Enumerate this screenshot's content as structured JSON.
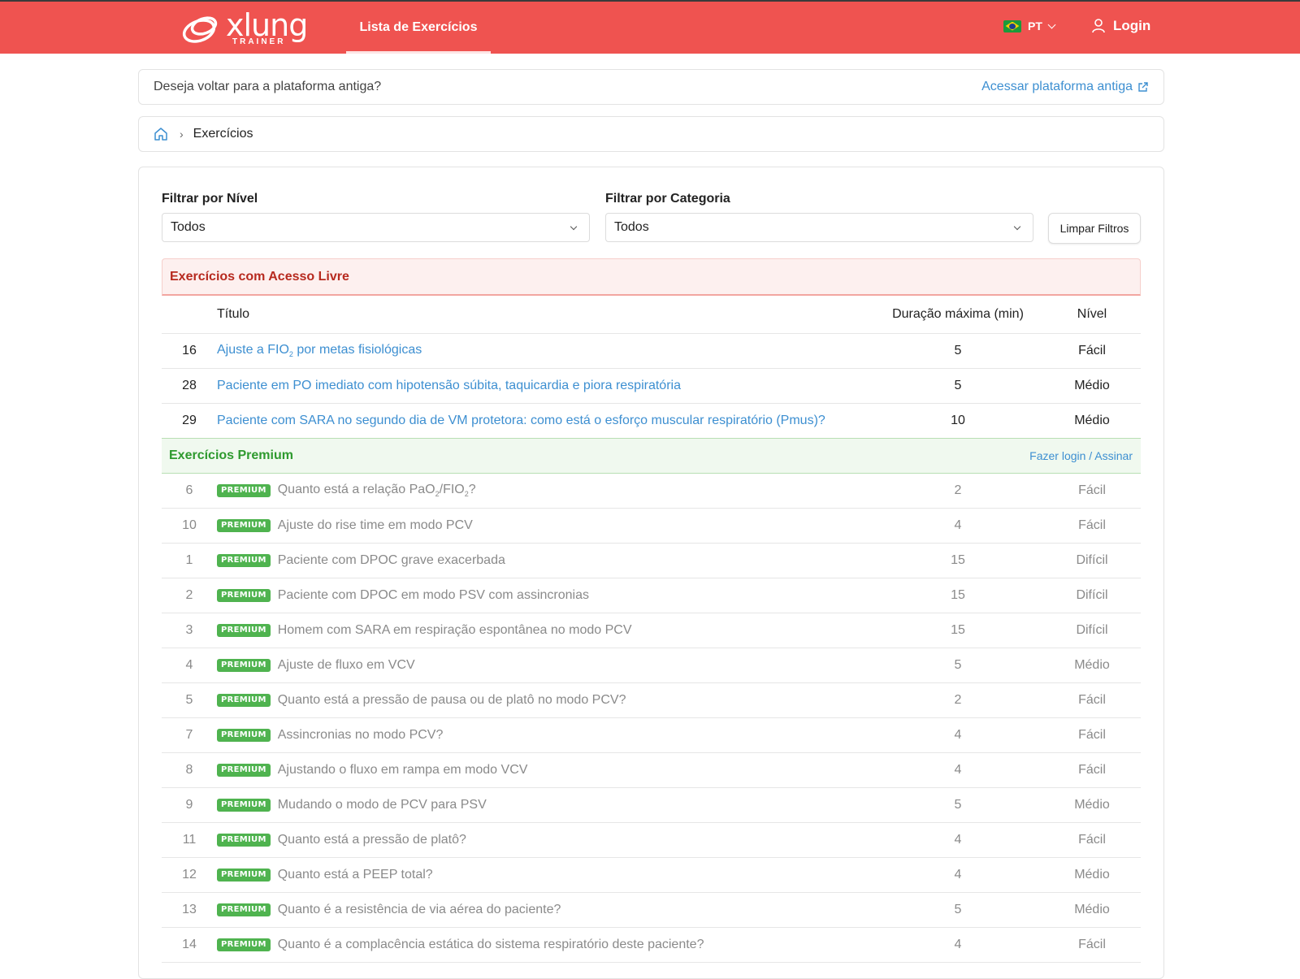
{
  "header": {
    "logo_main": "xlung",
    "logo_sub": "TRAINER",
    "nav_tab": "Lista de Exercícios",
    "lang": "PT",
    "login": "Login"
  },
  "notice": {
    "text": "Deseja voltar para a plataforma antiga?",
    "link": "Acessar plataforma antiga"
  },
  "breadcrumb": {
    "current": "Exercícios"
  },
  "filters": {
    "level_label": "Filtrar por Nível",
    "level_value": "Todos",
    "category_label": "Filtrar por Categoria",
    "category_value": "Todos",
    "clear_button": "Limpar Filtros"
  },
  "free_section": {
    "title": "Exercícios com Acesso Livre",
    "columns": {
      "title": "Título",
      "duration": "Duração máxima (min)",
      "level": "Nível"
    },
    "rows": [
      {
        "id": "16",
        "title_pre": "Ajuste a FIO",
        "title_sub": "2",
        "title_post": " por metas fisiológicas",
        "duration": "5",
        "level": "Fácil"
      },
      {
        "id": "28",
        "title": "Paciente em PO imediato com hipotensão súbita, taquicardia e piora respiratória",
        "duration": "5",
        "level": "Médio"
      },
      {
        "id": "29",
        "title": "Paciente com SARA no segundo dia de VM protetora: como está o esforço muscular respiratório (Pmus)?",
        "duration": "10",
        "level": "Médio"
      }
    ]
  },
  "premium_section": {
    "title": "Exercícios Premium",
    "link": "Fazer login / Assinar",
    "badge": "PREMIUM",
    "rows": [
      {
        "id": "6",
        "title_a": "Quanto está a relação PaO",
        "sub1": "2",
        "title_b": "/FIO",
        "sub2": "2",
        "title_c": "?",
        "duration": "2",
        "level": "Fácil"
      },
      {
        "id": "10",
        "title": "Ajuste do rise time em modo PCV",
        "duration": "4",
        "level": "Fácil"
      },
      {
        "id": "1",
        "title": "Paciente com DPOC grave exacerbada",
        "duration": "15",
        "level": "Difícil"
      },
      {
        "id": "2",
        "title": "Paciente com DPOC em modo PSV com assincronias",
        "duration": "15",
        "level": "Difícil"
      },
      {
        "id": "3",
        "title": "Homem com SARA em respiração espontânea no modo PCV",
        "duration": "15",
        "level": "Difícil"
      },
      {
        "id": "4",
        "title": "Ajuste de fluxo em VCV",
        "duration": "5",
        "level": "Médio"
      },
      {
        "id": "5",
        "title": "Quanto está a pressão de pausa ou de platô no modo PCV?",
        "duration": "2",
        "level": "Fácil"
      },
      {
        "id": "7",
        "title": "Assincronias no modo PCV?",
        "duration": "4",
        "level": "Fácil"
      },
      {
        "id": "8",
        "title": "Ajustando o fluxo em rampa em modo VCV",
        "duration": "4",
        "level": "Fácil"
      },
      {
        "id": "9",
        "title": "Mudando o modo de PCV para PSV",
        "duration": "5",
        "level": "Médio"
      },
      {
        "id": "11",
        "title": "Quanto está a pressão de platô?",
        "duration": "4",
        "level": "Fácil"
      },
      {
        "id": "12",
        "title": "Quanto está a PEEP total?",
        "duration": "4",
        "level": "Médio"
      },
      {
        "id": "13",
        "title": "Quanto é a resistência de via aérea do paciente?",
        "duration": "5",
        "level": "Médio"
      },
      {
        "id": "14",
        "title": "Quanto é a complacência estática do sistema respiratório deste paciente?",
        "duration": "4",
        "level": "Fácil"
      }
    ]
  },
  "colors": {
    "brand": "#ef5350",
    "link": "#3d8fd1",
    "premium": "#4fb34f"
  }
}
